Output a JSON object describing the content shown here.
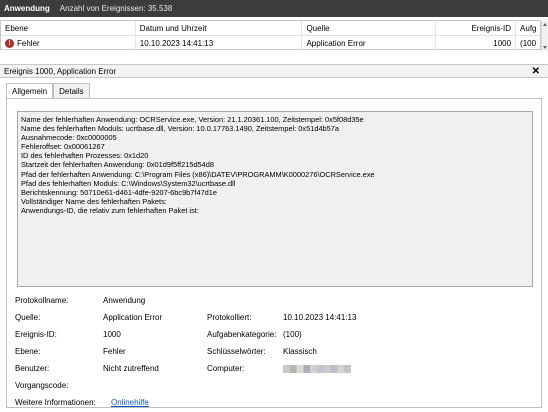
{
  "header": {
    "title": "Anwendung",
    "event_count": "Anzahl von Ereignissen: 35.538"
  },
  "events_table": {
    "columns": [
      "Ebene",
      "Datum und Uhrzeit",
      "Quelle",
      "Ereignis-ID",
      "Aufg"
    ],
    "rows": [
      {
        "level": "Fehler",
        "datetime": "10.10.2023 14:41:13",
        "source": "Application Error",
        "event_id": "1000",
        "task": "(100"
      }
    ]
  },
  "detail": {
    "title": "Ereignis 1000, Application Error",
    "close_icon": "close-icon",
    "tabs": [
      "Allgemein",
      "Details"
    ],
    "active_tab": "Allgemein",
    "message_lines": [
      "Name der fehlerhaften Anwendung: OCRService.exe, Version: 21.1.20361.100, Zeitstempel: 0x5f08d35e",
      "Name des fehlerhaften Moduls: ucrtbase.dll, Version: 10.0.17763.1490, Zeitstempel: 0x51d4b57a",
      "Ausnahmecode: 0xc0000005",
      "Fehleroffset: 0x00061267",
      "ID des fehlerhaften Prozesses: 0x1d20",
      "Startzeit der fehlerhaften Anwendung: 0x01d9f5ff215d54d8",
      "Pfad der fehlerhaften Anwendung: C:\\Program Files (x86)\\DATEV\\PROGRAMM\\K0000276\\OCRService.exe",
      "Pfad des fehlerhaften Moduls: C:\\Windows\\System32\\ucrtbase.dll",
      "Berichtskennung: 50710e61-d461-4dfe-9207-6bc9b7f47d1e",
      "Vollständiger Name des fehlerhaften Pakets:",
      "Anwendungs-ID, die relativ zum fehlerhaften Paket ist:"
    ],
    "properties": {
      "protokollname_label": "Protokollname:",
      "protokollname_value": "Anwendung",
      "quelle_label": "Quelle:",
      "quelle_value": "Application Error",
      "protokolliert_label": "Protokolliert:",
      "protokolliert_value": "10.10.2023 14:41:13",
      "ereignis_id_label": "Ereignis-ID:",
      "ereignis_id_value": "1000",
      "aufgabenkategorie_label": "Aufgabenkategorie:",
      "aufgabenkategorie_value": "(100)",
      "ebene_label": "Ebene:",
      "ebene_value": "Fehler",
      "schluesselwoerter_label": "Schlüsselwörter:",
      "schluesselwoerter_value": "Klassisch",
      "benutzer_label": "Benutzer:",
      "benutzer_value": "Nicht zutreffend",
      "computer_label": "Computer:",
      "vorgangscode_label": "Vorgangscode:",
      "weitere_label": "Weitere Informationen:",
      "weitere_link": "Onlinehilfe"
    }
  }
}
